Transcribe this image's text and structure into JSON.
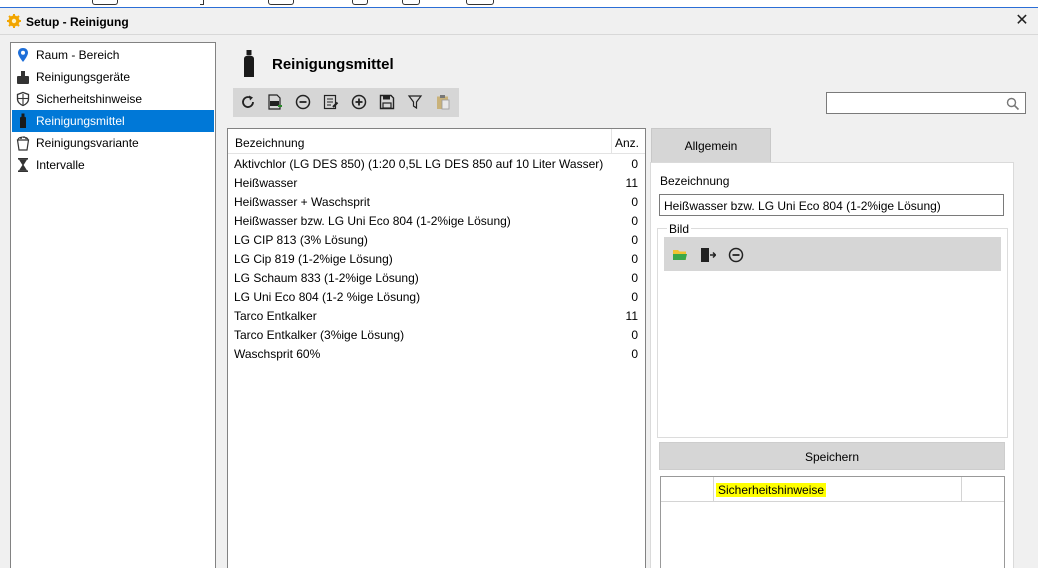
{
  "window": {
    "title": "Setup - Reinigung",
    "close_glyph": "✕"
  },
  "sidebar": {
    "items": [
      {
        "label": "Raum - Bereich",
        "icon": "location-pin-icon"
      },
      {
        "label": "Reinigungsgeräte",
        "icon": "device-icon"
      },
      {
        "label": "Sicherheitshinweise",
        "icon": "shield-icon"
      },
      {
        "label": "Reinigungsmittel",
        "icon": "bottle-icon",
        "selected": true
      },
      {
        "label": "Reinigungsvariante",
        "icon": "bucket-icon"
      },
      {
        "label": "Intervalle",
        "icon": "hourglass-icon"
      }
    ]
  },
  "main": {
    "heading": "Reinigungsmittel",
    "toolbar": [
      "refresh-icon",
      "export-icon",
      "remove-icon",
      "edit-icon",
      "add-icon",
      "save-icon",
      "filter-icon",
      "clipboard-icon"
    ],
    "search": {
      "placeholder": "",
      "value": ""
    }
  },
  "list": {
    "columns": {
      "name": "Bezeichnung",
      "count": "Anz."
    },
    "rows": [
      {
        "name": "Aktivchlor (LG DES 850) (1:20 0,5L LG DES 850 auf 10 Liter Wasser)",
        "count": "0"
      },
      {
        "name": "Heißwasser",
        "count": "11"
      },
      {
        "name": "Heißwasser + Waschsprit",
        "count": "0"
      },
      {
        "name": "Heißwasser bzw. LG Uni Eco 804 (1-2%ige Lösung)",
        "count": "0"
      },
      {
        "name": "LG CIP 813 (3% Lösung)",
        "count": "0"
      },
      {
        "name": "LG Cip 819 (1-2%ige Lösung)",
        "count": "0"
      },
      {
        "name": "LG Schaum 833 (1-2%ige Lösung)",
        "count": "0"
      },
      {
        "name": "LG Uni Eco 804 (1-2 %ige Lösung)",
        "count": "0"
      },
      {
        "name": "Tarco Entkalker",
        "count": "11"
      },
      {
        "name": "Tarco Entkalker (3%ige Lösung)",
        "count": "0"
      },
      {
        "name": "Waschsprit 60%",
        "count": "0"
      }
    ]
  },
  "detail": {
    "tab": "Allgemein",
    "name_label": "Bezeichnung",
    "name_value": "Heißwasser bzw. LG Uni Eco 804 (1-2%ige Lösung)",
    "image_group": "Bild",
    "image_toolbar": [
      "open-folder-icon",
      "exit-icon",
      "remove-icon"
    ],
    "save_label": "Speichern",
    "grid_column": "Sicherheitshinweise"
  },
  "colors": {
    "selection": "#0078d7",
    "highlight": "#ffff00",
    "toolbar_bg": "#d6d6d6"
  }
}
